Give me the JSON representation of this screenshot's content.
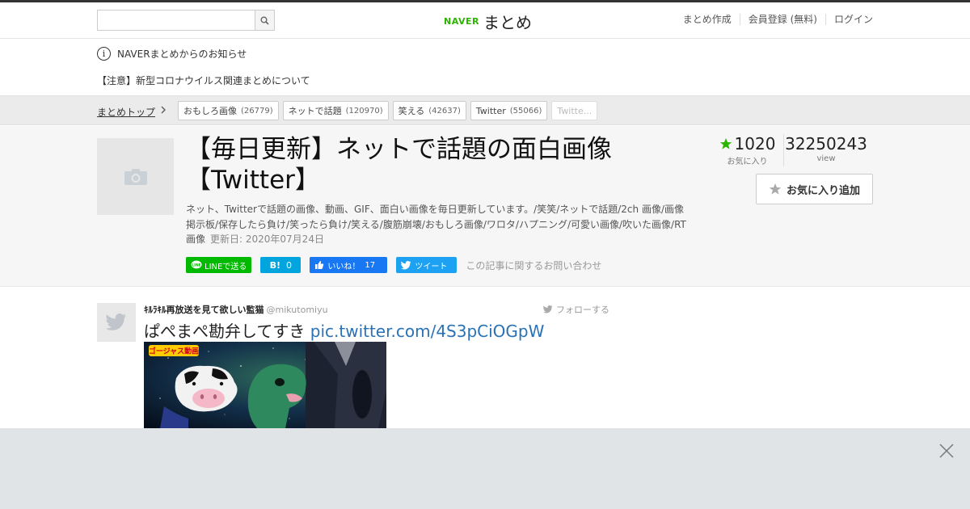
{
  "header": {
    "search_placeholder": "",
    "logo_naver": "NAVER",
    "logo_matome": "まとめ",
    "nav": [
      "まとめ作成",
      "会員登録 (無料)",
      "ログイン"
    ]
  },
  "notice": {
    "text": "NAVERまとめからのお知らせ",
    "alert": "【注意】新型コロナウイルス関連まとめについて"
  },
  "categories": {
    "top": "まとめトップ",
    "tags": [
      {
        "label": "おもしろ画像",
        "count": "(26779)"
      },
      {
        "label": "ネットで話題",
        "count": "(120970)"
      },
      {
        "label": "笑える",
        "count": "(42637)"
      },
      {
        "label": "Twitter",
        "count": "(55066)"
      },
      {
        "label": "Twitte...",
        "count": ""
      }
    ]
  },
  "article": {
    "title": "【毎日更新】ネットで話題の面白画像【Twitter】",
    "description": "ネット、Twitterで話題の画像、動画、GIF、面白い画像を毎日更新しています。/笑笑/ネットで話題/2ch 画像/画像掲示板/保存したら負け/笑ったら負け/笑える/腹筋崩壊/おもしろ画像/ワロタ/ハプニング/可愛い画像/吹いた画像/RT画像",
    "updated": "更新日: 2020年07月24日",
    "favorites": "1020",
    "favorites_label": "お気に入り",
    "views": "32250243",
    "views_label": "view",
    "fav_button": "お気に入り追加",
    "share": {
      "line": "LINEで送る",
      "hatena_b": "B!",
      "hatena_count": "0",
      "fb": "いいね！",
      "fb_count": "17",
      "tw": "ツイート"
    },
    "inquiry": "この記事に関するお問い合わせ"
  },
  "tweet": {
    "name": "ｷﾙﾗｷﾙ再放送を見て欲しい監猫",
    "handle": "@mikutomiyu",
    "follow": "フォローする",
    "text": "ぱぺまぺ勘弁してすき",
    "link": "pic.twitter.com/4S3pCiOGpW",
    "image_caption": "ゴージャス動画"
  },
  "colors": {
    "naver_green": "#2db400",
    "line": "#00b900",
    "hatena": "#00a4de",
    "facebook": "#1877f2",
    "twitter": "#1da1f2",
    "star": "#2db400"
  }
}
